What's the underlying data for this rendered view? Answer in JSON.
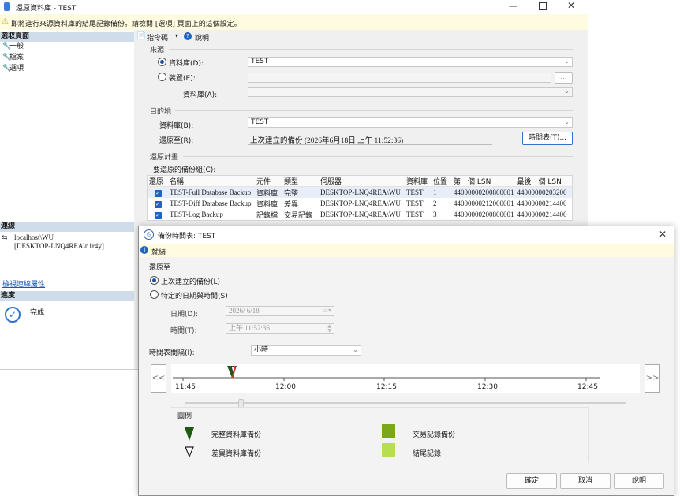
{
  "main_window": {
    "title": "還原資料庫 - TEST",
    "warning": "即將進行來源資料庫的結尾記錄備份。請檢閱 [選項] 頁面上的這個設定。",
    "left_pane": {
      "select_page_header": "選取頁面",
      "pages": [
        "一般",
        "檔案",
        "選項"
      ],
      "connection_header": "連線",
      "connection_server": "localhost\\WU",
      "connection_user": "[DESKTOP-LNQ4REA\\n1r4y]",
      "view_connection_link": "檢視連線屬性",
      "progress_header": "進度",
      "progress_status": "完成"
    },
    "toolbar": {
      "script_label": "指令碼",
      "help_label": "說明"
    },
    "source": {
      "section_label": "來源",
      "database_radio_label": "資料庫(D):",
      "database_value": "TEST",
      "device_radio_label": "裝置(E):",
      "device_browse_label": "...",
      "device_database_label": "資料庫(A):"
    },
    "destination": {
      "section_label": "目的地",
      "database_label": "資料庫(B):",
      "database_value": "TEST",
      "restore_to_label": "還原至(R):",
      "restore_to_value": "上次建立的備份 (2026年6月18日 上午 11:52:36)",
      "timeline_button": "時間表(T)..."
    },
    "restore_plan": {
      "section_label": "還原計畫",
      "backup_sets_label": "要還原的備份組(C):",
      "columns": [
        "還原",
        "名稱",
        "元件",
        "類型",
        "伺服器",
        "資料庫",
        "位置",
        "第一個 LSN",
        "最後一個 LSN"
      ],
      "rows": [
        {
          "name": "TEST-Full Database Backup",
          "component": "資料庫",
          "type": "完整",
          "server": "DESKTOP-LNQ4REA\\WU",
          "database": "TEST",
          "position": "1",
          "first_lsn": "44000000200800001",
          "last_lsn": "44000000203200"
        },
        {
          "name": "TEST-Diff Database Backup",
          "component": "資料庫",
          "type": "差異",
          "server": "DESKTOP-LNQ4REA\\WU",
          "database": "TEST",
          "position": "2",
          "first_lsn": "44000000212000001",
          "last_lsn": "44000000214400"
        },
        {
          "name": "TEST-Log Backup",
          "component": "記錄檔",
          "type": "交易記錄",
          "server": "DESKTOP-LNQ4REA\\WU",
          "database": "TEST",
          "position": "3",
          "first_lsn": "44000000200800001",
          "last_lsn": "44000000214400"
        }
      ]
    }
  },
  "dialog": {
    "title": "備份時間表: TEST",
    "info": "就緒",
    "restore_to_label": "還原至",
    "option_last_backup": "上次建立的備份(L)",
    "option_specific": "特定的日期與時間(S)",
    "date_label": "日期(D):",
    "date_value": "2026/ 6/18",
    "time_label": "時間(T):",
    "time_value": "上午 11:52:36",
    "interval_label": "時間表間隔(I):",
    "interval_value": "小時",
    "nav_prev": "<<",
    "nav_next": ">>",
    "ticks": [
      "11:45",
      "12:00",
      "12:15",
      "12:30",
      "12:45"
    ],
    "legend_title": "圖例",
    "legend": {
      "full_backup": "完整資料庫備份",
      "diff_backup": "差異資料庫備份",
      "log_backup": "交易記錄備份",
      "tail_log": "結尾記錄"
    },
    "buttons": {
      "ok": "確定",
      "cancel": "取消",
      "help": "說明"
    },
    "colors": {
      "full_backup": "#1e5a14",
      "log_backup": "#7aa818",
      "tail_log": "#b7dd50",
      "marker": "#d93b2b"
    }
  }
}
